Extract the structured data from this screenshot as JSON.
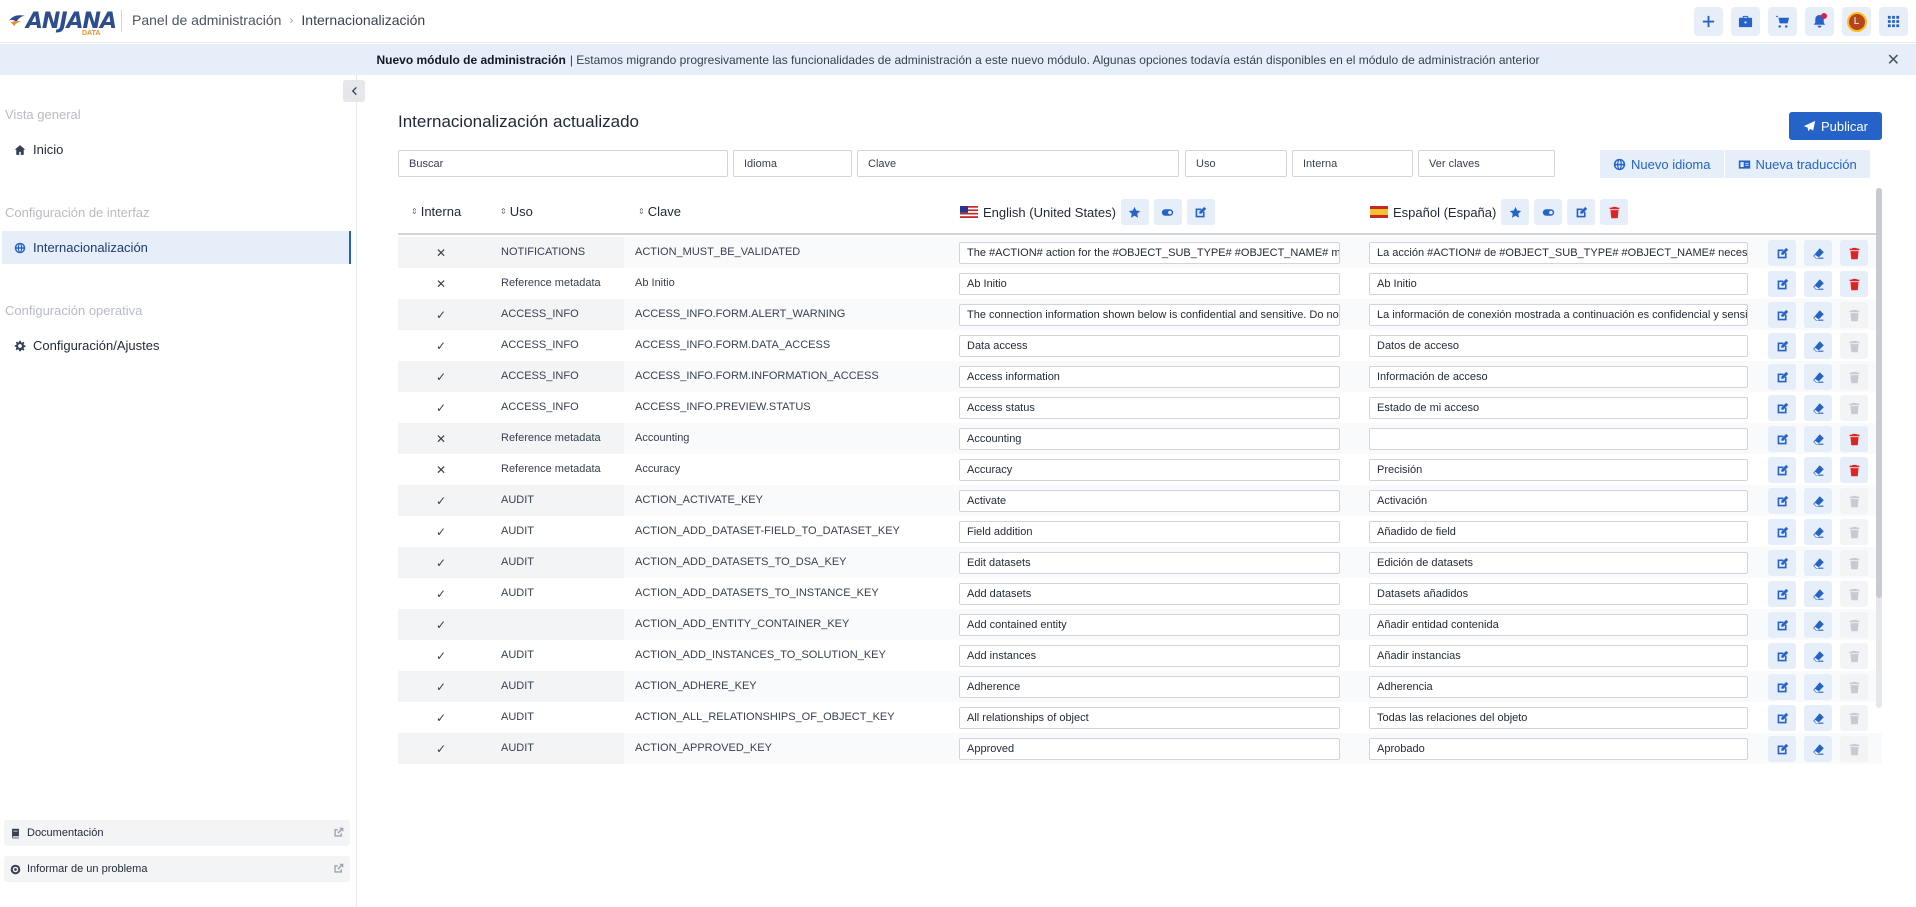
{
  "header": {
    "logo_text": "ANJANA",
    "logo_sub": "DATA",
    "breadcrumb": [
      "Panel de administración",
      "Internacionalización"
    ],
    "avatar_initial": "L"
  },
  "banner": {
    "title": "Nuevo módulo de administración",
    "text": "| Estamos migrando progresivamente las funcionalidades de administración a este nuevo módulo. Algunas opciones todavía están disponibles en el  módulo de administración anterior"
  },
  "sidebar": {
    "sections": [
      {
        "title": "Vista general",
        "item": "Inicio"
      },
      {
        "title": "Configuración de interfaz",
        "item": "Internacionalización"
      },
      {
        "title": "Configuración operativa",
        "item": "Configuración/Ajustes"
      }
    ],
    "footer": [
      "Documentación",
      "Informar de un problema"
    ]
  },
  "main": {
    "title": "Internacionalización actualizado",
    "publish_label": "Publicar",
    "filters": {
      "search": "Buscar",
      "language": "Idioma",
      "key": "Clave",
      "usage": "Uso",
      "internal": "Interna",
      "view_keys": "Ver claves"
    },
    "new_language_label": "Nuevo idioma",
    "new_translation_label": "Nueva traducción"
  },
  "table": {
    "columns": {
      "internal": "Interna",
      "usage": "Uso",
      "key": "Clave",
      "lang_en": "English (United States)",
      "lang_es": "Español (España)"
    },
    "rows": [
      {
        "internal": "✕",
        "usage": "NOTIFICATIONS",
        "key": "ACTION_MUST_BE_VALIDATED",
        "en": "The #ACTION# action for the #OBJECT_SUB_TYPE# #OBJECT_NAME# must be validated",
        "es": "La acción #ACTION# de #OBJECT_SUB_TYPE# #OBJECT_NAME# necesita validación",
        "deletable": true
      },
      {
        "internal": "✕",
        "usage": "Reference metadata",
        "key": "Ab Initio",
        "en": "Ab Initio",
        "es": "Ab Initio",
        "deletable": true
      },
      {
        "internal": "✓",
        "usage": "ACCESS_INFO",
        "key": "ACCESS_INFO.FORM.ALERT_WARNING",
        "en": "The connection information shown below is confidential and sensitive. Do not share it",
        "es": "La información de conexión mostrada a continuación es confidencial y sensible",
        "deletable": false
      },
      {
        "internal": "✓",
        "usage": "ACCESS_INFO",
        "key": "ACCESS_INFO.FORM.DATA_ACCESS",
        "en": "Data access",
        "es": "Datos de acceso",
        "deletable": false
      },
      {
        "internal": "✓",
        "usage": "ACCESS_INFO",
        "key": "ACCESS_INFO.FORM.INFORMATION_ACCESS",
        "en": "Access information",
        "es": "Información de acceso",
        "deletable": false
      },
      {
        "internal": "✓",
        "usage": "ACCESS_INFO",
        "key": "ACCESS_INFO.PREVIEW.STATUS",
        "en": "Access status",
        "es": "Estado de mi acceso",
        "deletable": false
      },
      {
        "internal": "✕",
        "usage": "Reference metadata",
        "key": "Accounting",
        "en": "Accounting",
        "es": "",
        "deletable": true
      },
      {
        "internal": "✕",
        "usage": "Reference metadata",
        "key": "Accuracy",
        "en": "Accuracy",
        "es": "Precisión",
        "deletable": true
      },
      {
        "internal": "✓",
        "usage": "AUDIT",
        "key": "ACTION_ACTIVATE_KEY",
        "en": "Activate",
        "es": "Activación",
        "deletable": false
      },
      {
        "internal": "✓",
        "usage": "AUDIT",
        "key": "ACTION_ADD_DATASET-FIELD_TO_DATASET_KEY",
        "en": "Field addition",
        "es": "Añadido de field",
        "deletable": false
      },
      {
        "internal": "✓",
        "usage": "AUDIT",
        "key": "ACTION_ADD_DATASETS_TO_DSA_KEY",
        "en": "Edit datasets",
        "es": "Edición de datasets",
        "deletable": false
      },
      {
        "internal": "✓",
        "usage": "AUDIT",
        "key": "ACTION_ADD_DATASETS_TO_INSTANCE_KEY",
        "en": "Add datasets",
        "es": "Datasets añadidos",
        "deletable": false
      },
      {
        "internal": "✓",
        "usage": "",
        "key": "ACTION_ADD_ENTITY_CONTAINER_KEY",
        "en": "Add contained entity",
        "es": "Añadir entidad contenida",
        "deletable": false
      },
      {
        "internal": "✓",
        "usage": "AUDIT",
        "key": "ACTION_ADD_INSTANCES_TO_SOLUTION_KEY",
        "en": "Add instances",
        "es": "Añadir instancias",
        "deletable": false
      },
      {
        "internal": "✓",
        "usage": "AUDIT",
        "key": "ACTION_ADHERE_KEY",
        "en": "Adherence",
        "es": "Adherencia",
        "deletable": false
      },
      {
        "internal": "✓",
        "usage": "AUDIT",
        "key": "ACTION_ALL_RELATIONSHIPS_OF_OBJECT_KEY",
        "en": "All relationships of object",
        "es": "Todas las relaciones del objeto",
        "deletable": false
      },
      {
        "internal": "✓",
        "usage": "AUDIT",
        "key": "ACTION_APPROVED_KEY",
        "en": "Approved",
        "es": "Aprobado",
        "deletable": false
      }
    ]
  },
  "colors": {
    "accent": "#2563c9",
    "accent_light": "#e6eef9",
    "danger": "#dc2626",
    "banner_bg": "#e6eef9"
  },
  "icons": [
    "plus-icon",
    "briefcase-icon",
    "cart-icon",
    "bell-icon",
    "grid-icon",
    "home-icon",
    "globe-icon",
    "gear-icon",
    "book-icon",
    "support-icon",
    "external-link-icon",
    "paper-plane-icon",
    "id-card-icon",
    "star-icon",
    "toggle-icon",
    "edit-icon",
    "eraser-icon",
    "trash-icon",
    "chevron-left-icon",
    "close-icon"
  ]
}
